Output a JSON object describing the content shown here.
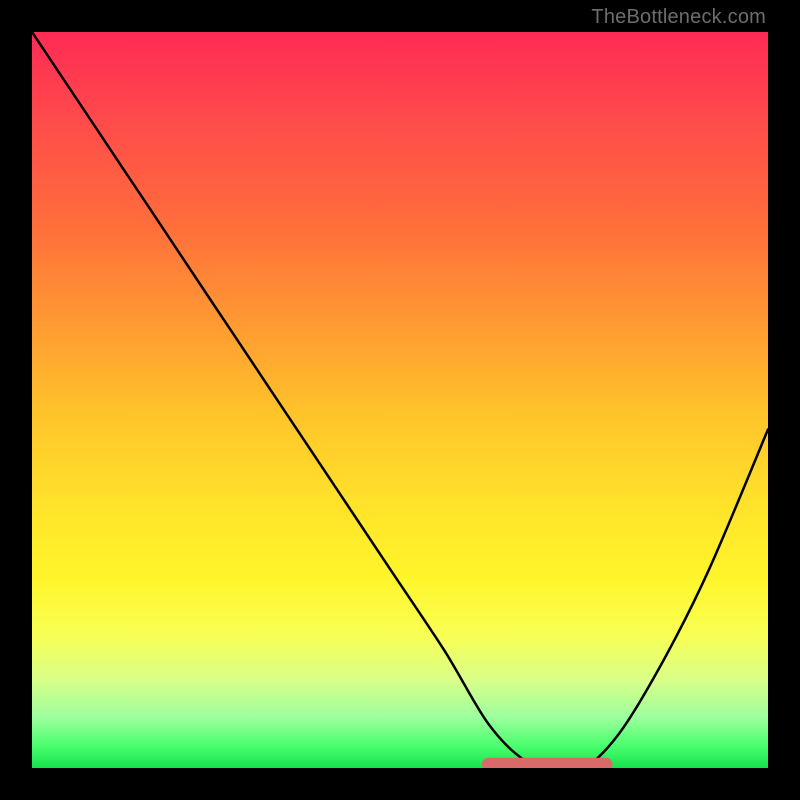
{
  "attribution": "TheBottleneck.com",
  "chart_data": {
    "type": "line",
    "title": "",
    "xlabel": "",
    "ylabel": "",
    "xlim": [
      0,
      100
    ],
    "ylim": [
      0,
      100
    ],
    "series": [
      {
        "name": "bottleneck-curve",
        "x": [
          0,
          8,
          16,
          24,
          32,
          40,
          48,
          56,
          62,
          67,
          71,
          75,
          80,
          86,
          92,
          100
        ],
        "values": [
          100,
          88,
          76,
          64,
          52,
          40,
          28,
          16,
          6,
          1,
          0,
          0,
          5,
          15,
          27,
          46
        ]
      },
      {
        "name": "optimal-range-marker",
        "x": [
          62,
          66,
          70,
          74,
          78
        ],
        "values": [
          0.5,
          0.5,
          0.5,
          0.5,
          0.5
        ]
      }
    ],
    "colors": {
      "curve": "#000000",
      "marker": "#d96a6a",
      "gradient_top": "#ff2a55",
      "gradient_bottom": "#16e24e"
    }
  }
}
